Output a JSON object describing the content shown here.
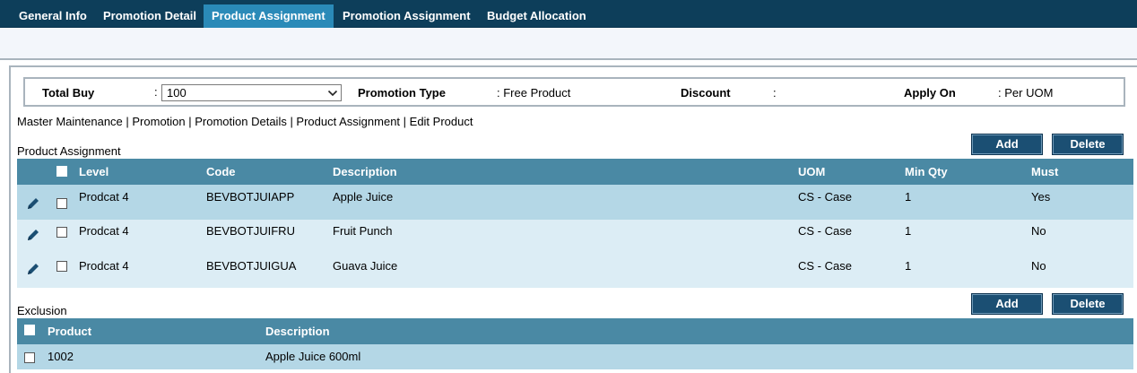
{
  "tabs": [
    {
      "label": "General Info",
      "active": false
    },
    {
      "label": "Promotion Detail",
      "active": false
    },
    {
      "label": "Product Assignment",
      "active": true
    },
    {
      "label": "Promotion Assignment",
      "active": false
    },
    {
      "label": "Budget Allocation",
      "active": false
    }
  ],
  "filter": {
    "total_buy_label": "Total Buy",
    "total_buy_colon": ":",
    "total_buy_value": "100",
    "promotion_type_label": "Promotion Type",
    "promotion_type_value": ": Free Product",
    "discount_label": "Discount",
    "discount_value": ":",
    "apply_on_label": "Apply On",
    "apply_on_value": ": Per UOM"
  },
  "breadcrumb": "Master Maintenance | Promotion | Promotion Details | Product Assignment | Edit Product",
  "product_assignment": {
    "title": "Product Assignment",
    "add_label": "Add",
    "delete_label": "Delete",
    "columns": {
      "level": "Level",
      "code": "Code",
      "description": "Description",
      "uom": "UOM",
      "min_qty": "Min Qty",
      "must": "Must"
    },
    "rows": [
      {
        "level": "Prodcat 4",
        "code": "BEVBOTJUIAPP",
        "description": "Apple Juice",
        "uom": "CS - Case",
        "min_qty": "1",
        "must": "Yes"
      },
      {
        "level": "Prodcat 4",
        "code": "BEVBOTJUIFRU",
        "description": "Fruit Punch",
        "uom": "CS - Case",
        "min_qty": "1",
        "must": "No"
      },
      {
        "level": "Prodcat 4",
        "code": "BEVBOTJUIGUA",
        "description": "Guava Juice",
        "uom": "CS - Case",
        "min_qty": "1",
        "must": "No"
      }
    ]
  },
  "exclusion": {
    "title": "Exclusion",
    "add_label": "Add",
    "delete_label": "Delete",
    "columns": {
      "product": "Product",
      "description": "Description"
    },
    "rows": [
      {
        "product": "1002",
        "description": "Apple Juice 600ml"
      }
    ]
  },
  "icons": {
    "edit": "pencil-icon",
    "dropdown": "chevron-down-icon"
  },
  "colors": {
    "tabbar": "#0d3e5a",
    "active_tab": "#2a8ab8",
    "table_header": "#4a89a4",
    "row_odd": "#b4d7e6",
    "row_even": "#dcedf5",
    "button": "#1b4f73"
  }
}
